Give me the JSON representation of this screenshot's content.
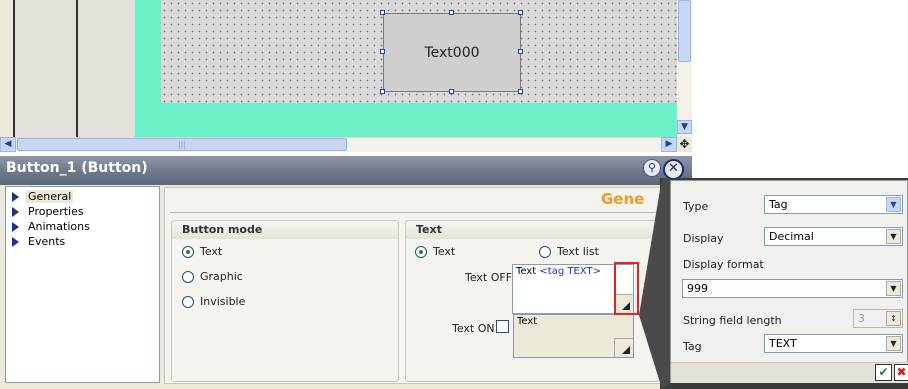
{
  "canvas": {
    "button_object_text": "Text000"
  },
  "properties": {
    "title": "Button_1 (Button)",
    "pin_symbol": "⚲",
    "close_symbol": "✕"
  },
  "nav": {
    "items": [
      {
        "label": "General",
        "selected": true
      },
      {
        "label": "Properties",
        "selected": false
      },
      {
        "label": "Animations",
        "selected": false
      },
      {
        "label": "Events",
        "selected": false
      }
    ]
  },
  "general": {
    "title": "Gene",
    "button_mode": {
      "header": "Button mode",
      "options": [
        {
          "label": "Text",
          "checked": true
        },
        {
          "label": "Graphic",
          "checked": false
        },
        {
          "label": "Invisible",
          "checked": false
        }
      ]
    },
    "text_group": {
      "header": "Text",
      "radio_text": "Text",
      "radio_textlist": "Text list",
      "text_off_label": "Text OFF",
      "text_off_value_plain": "Text",
      "text_off_value_tag": "<tag TEXT>",
      "text_on_label": "Text ON",
      "text_on_value": "Text"
    }
  },
  "popup": {
    "type_label": "Type",
    "type_value": "Tag",
    "display_label": "Display",
    "display_value": "Decimal",
    "display_format_label": "Display format",
    "display_format_value": "999",
    "string_length_label": "String field length",
    "string_length_value": "3",
    "tag_label": "Tag",
    "tag_value": "TEXT"
  },
  "colors": {
    "workspace": "#6cf0c8",
    "title_accent": "#f19a26",
    "highlight": "#e02424"
  }
}
